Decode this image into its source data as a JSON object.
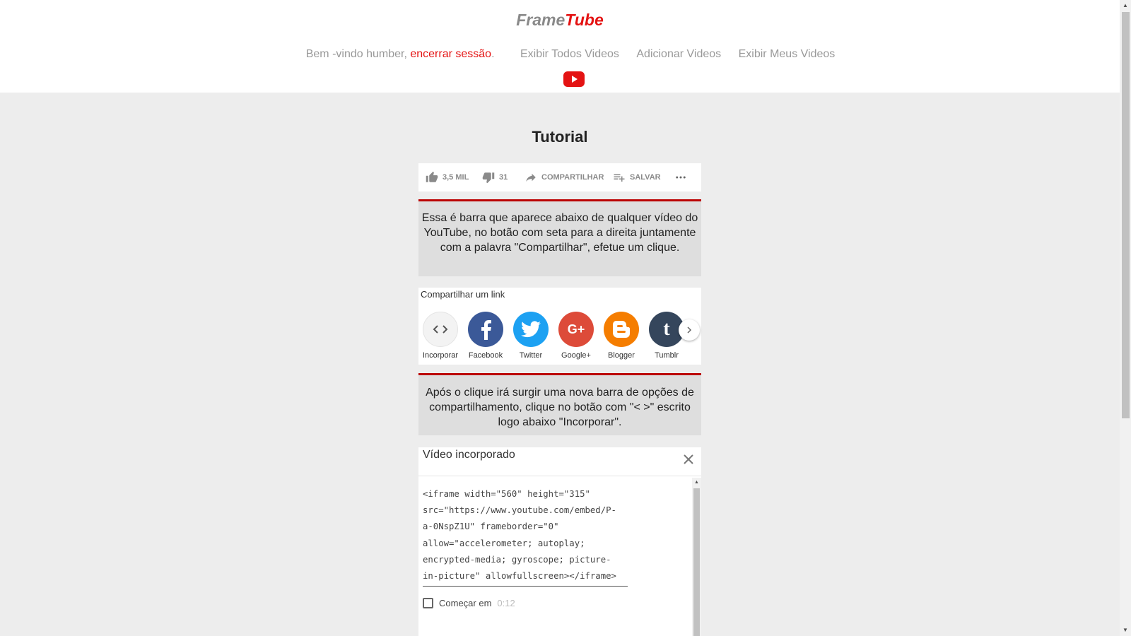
{
  "header": {
    "logo_part1": "Frame",
    "logo_part2": "Tube",
    "welcome_text": "Bem -vindo humber, ",
    "logout_label": "encerrar sessão",
    "welcome_suffix": ".",
    "nav_items": [
      {
        "label": "Exibir Todos Videos"
      },
      {
        "label": "Adicionar Videos"
      },
      {
        "label": "Exibir Meus Videos"
      }
    ],
    "icon": "youtube-icon"
  },
  "main": {
    "title": "Tutorial",
    "action_bar": {
      "like_count": "3,5 MIL",
      "dislike_count": "31",
      "share_label": "COMPARTILHAR",
      "save_label": "SALVAR"
    },
    "instruction1": "Essa é barra que aparece abaixo de qualquer vídeo do YouTube, no botão com seta para a direita juntamente com a palavra \"Compartilhar\", efetue um clique.",
    "share_panel": {
      "title": "Compartilhar um link",
      "items": [
        {
          "label": "Incorporar",
          "icon": "embed-code-icon"
        },
        {
          "label": "Facebook",
          "icon": "facebook-icon",
          "color": "#3b5998"
        },
        {
          "label": "Twitter",
          "icon": "twitter-icon",
          "color": "#1da1f2"
        },
        {
          "label": "Google+",
          "icon": "google-plus-icon",
          "color": "#dd4b39"
        },
        {
          "label": "Blogger",
          "icon": "blogger-icon",
          "color": "#f57d00"
        },
        {
          "label": "Tumblr",
          "icon": "tumblr-icon",
          "color": "#35465c"
        }
      ]
    },
    "instruction2": "Após o clique irá surgir uma nova barra de opções de compartilhamento, clique no botão com \"< >\" escrito logo abaixo \"Incorporar\".",
    "embed_panel": {
      "title": "Vídeo incorporado",
      "code": "<iframe width=\"560\" height=\"315\"\nsrc=\"https://www.youtube.com/embed/P-\na-0NspZ1U\" frameborder=\"0\"\nallow=\"accelerometer; autoplay;\nencrypted-media; gyroscope; picture-\nin-picture\" allowfullscreen></iframe>",
      "start_label": "Começar em",
      "start_time": "0:12"
    }
  },
  "colors": {
    "accent_red": "#e41313",
    "instruction_border": "#bb0000",
    "page_bg": "#ededed"
  }
}
